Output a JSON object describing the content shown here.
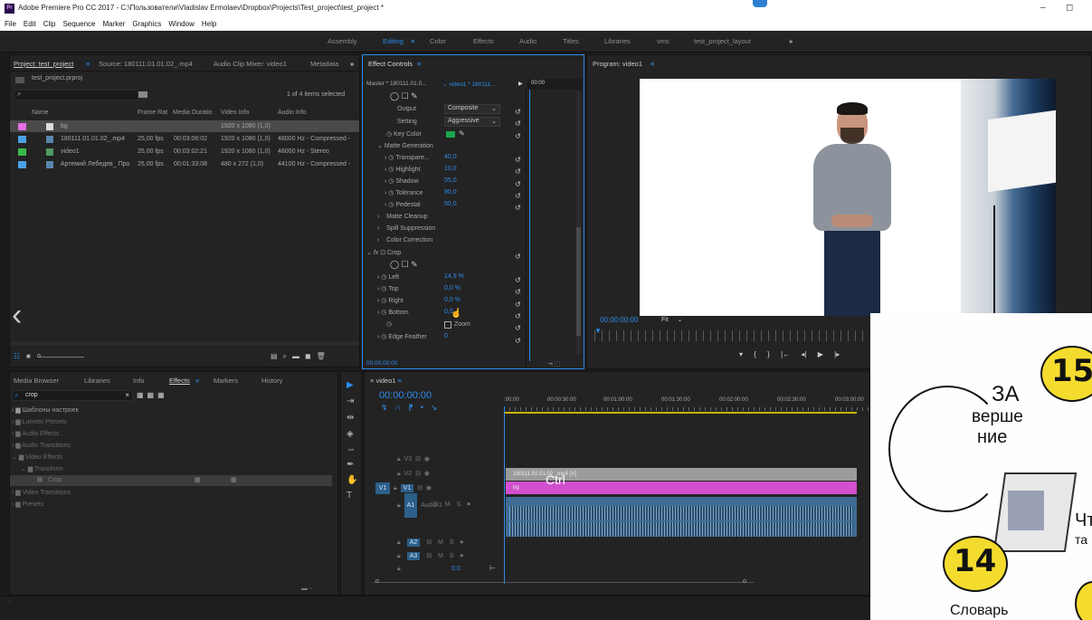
{
  "app": {
    "title": "Adobe Premiere Pro CC 2017 - C:\\Пользователи\\Vladislav Ermolaev\\Dropbox\\Projects\\Test_project\\test_project *",
    "icon": "Pr",
    "minimize": "–",
    "maximize": "◻"
  },
  "menu": [
    "File",
    "Edit",
    "Clip",
    "Sequence",
    "Marker",
    "Graphics",
    "Window",
    "Help"
  ],
  "workspaces": [
    "Assembly",
    "Editing",
    "Color",
    "Effects",
    "Audio",
    "Titles",
    "Libraries",
    "vms",
    "test_project_layout",
    "»"
  ],
  "project": {
    "tabs": [
      "Project: test_project",
      "Source: 180111.01.01.02_.mp4",
      "Audio Clip Mixer: video1",
      "Metadata",
      "»"
    ],
    "file": "test_project.prproj",
    "count": "1 of 4 items selected",
    "columns": [
      "Name",
      "Frame Rat",
      "Media Duratio",
      "Video Info",
      "Audio Info"
    ],
    "rows": [
      {
        "name": "bg",
        "fps": "",
        "dur": "",
        "video": "1920 x 1080 (1,0)",
        "audio": "",
        "color": "#e56fe6"
      },
      {
        "name": "180111.01.01.02_.mp4",
        "fps": "25,00 fps",
        "dur": "00:03:06:02",
        "video": "1920 x 1080 (1,0)",
        "audio": "48000 Hz - Compressed -",
        "color": "#4aa0e6"
      },
      {
        "name": "video1",
        "fps": "25,00 fps",
        "dur": "00:03:02:21",
        "video": "1920 x 1080 (1,0)",
        "audio": "48000 Hz - Stereo",
        "color": "#3bbb48"
      },
      {
        "name": "Артемий Лебедев_ Про",
        "fps": "25,00 fps",
        "dur": "00:01:33:08",
        "video": "480 x 272 (1,0)",
        "audio": "44100 Hz - Compressed -",
        "color": "#4aa0e6"
      }
    ]
  },
  "effect_controls": {
    "title": "Effect Controls",
    "master": "Master * 180111.01.0...",
    "clip": "video1 * 180111...",
    "time": "00:00",
    "timecode": "00:00:00:00",
    "output_label": "Output",
    "output_value": "Composite",
    "setting_label": "Setting",
    "setting_value": "Aggressive",
    "key_color_label": "Key Color",
    "matte_generation": "Matte Generation",
    "params1": [
      {
        "label": "Transpare...",
        "value": "40,0"
      },
      {
        "label": "Highlight",
        "value": "10,0"
      },
      {
        "label": "Shadow",
        "value": "55,0"
      },
      {
        "label": "Tolerance",
        "value": "90,0"
      },
      {
        "label": "Pedestal",
        "value": "50,0"
      }
    ],
    "groups": [
      "Matte Cleanup",
      "Spill Suppression",
      "Color Correction"
    ],
    "crop_label": "Crop",
    "params2": [
      {
        "label": "Left",
        "value": "14,9 %"
      },
      {
        "label": "Top",
        "value": "0,0 %"
      },
      {
        "label": "Right",
        "value": "0,0 %"
      },
      {
        "label": "Bottom",
        "value": "0,0"
      }
    ],
    "zoom_label": "Zoom",
    "edge_feather_label": "Edge Feather",
    "edge_feather_value": "0",
    "fx_label": "fx"
  },
  "program": {
    "title": "Program: video1",
    "timecode": "00:00:00:00",
    "fit": "Fit",
    "transport": [
      "▾",
      "{",
      "}",
      "|←",
      "◂|",
      "▶",
      "|▸"
    ]
  },
  "effects_panel": {
    "tabs": [
      "Media Browser",
      "Libraries",
      "Info",
      "Effects",
      "Markers",
      "History"
    ],
    "search": "crop",
    "tree": [
      {
        "label": "Шаблоны настроек",
        "indent": 0
      },
      {
        "label": "Lumetri Presets",
        "indent": 0
      },
      {
        "label": "Audio Effects",
        "indent": 0
      },
      {
        "label": "Audio Transitions",
        "indent": 0
      },
      {
        "label": "Video Effects",
        "indent": 0
      },
      {
        "label": "Transform",
        "indent": 1
      },
      {
        "label": "Crop",
        "indent": 2
      },
      {
        "label": "Video Transitions",
        "indent": 0
      },
      {
        "label": "Presets",
        "indent": 0
      }
    ]
  },
  "timeline": {
    "title": "video1",
    "timecode": "00:00:00:00",
    "ruler": [
      ":00:00",
      "00:00:30:00",
      "00:01:00:00",
      "00:01:30:00",
      "00:02:00:00",
      "00:02:30:00",
      "00:03:00:00"
    ],
    "tracks": [
      "V3",
      "V2",
      "V1",
      "A1",
      "A2",
      "A3"
    ],
    "source_v1": "V1",
    "audio1_label": "Audio 1",
    "clip1": "180111.01.01.02_.mp4 [V]",
    "clip2": "bg",
    "volume": "0,0",
    "overlay": "Ctrl"
  },
  "sketch": {
    "n15": "15",
    "n14": "14",
    "text1": "ЗА",
    "text2": "верше",
    "text3": "ние",
    "text4": "Словарь",
    "text5": "Чт",
    "text6": "та"
  },
  "colors": {
    "accent": "#2d8ceb",
    "magenta": "#d24fcf",
    "gray_clip": "#9b9b9b",
    "audio": "#3e6c94"
  }
}
